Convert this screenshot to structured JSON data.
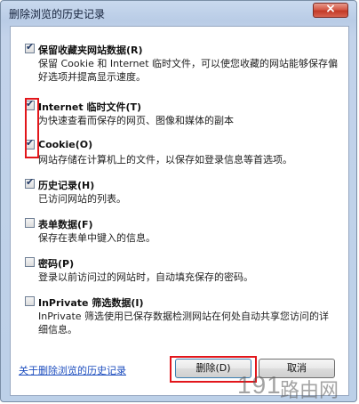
{
  "dialog": {
    "title": "删除浏览的历史记录",
    "close_symbol": "×"
  },
  "options": [
    {
      "key": "favorites",
      "checked": true,
      "title": "保留收藏夹网站数据(R)",
      "description": "保留 Cookie 和 Internet 临时文件，可以使您收藏的网站能够保存偏好选项并提高显示速度。"
    },
    {
      "key": "temp-files",
      "checked": true,
      "title": "Internet 临时文件(T)",
      "description": "为快速查看而保存的网页、图像和媒体的副本"
    },
    {
      "key": "cookies",
      "checked": true,
      "title": "Cookie(O)",
      "description": "网站存储在计算机上的文件，以保存如登录信息等首选项。"
    },
    {
      "key": "history",
      "checked": true,
      "title": "历史记录(H)",
      "description": "已访问网站的列表。"
    },
    {
      "key": "form-data",
      "checked": false,
      "title": "表单数据(F)",
      "description": "保存在表单中键入的信息。"
    },
    {
      "key": "passwords",
      "checked": false,
      "title": "密码(P)",
      "description": "登录以前访问过的网站时，自动填充保存的密码。"
    },
    {
      "key": "inprivate",
      "checked": false,
      "title": "InPrivate 筛选数据(I)",
      "description": "InPrivate 筛选使用已保存数据检测网站在何处自动共享您访问的详细信息。"
    }
  ],
  "footer": {
    "help_link": "关于删除浏览的历史记录",
    "delete_label": "删除(D)",
    "cancel_label": "取消"
  },
  "watermark": {
    "number": "191",
    "text": "路由网"
  },
  "colors": {
    "highlight": "#e2161b",
    "link": "#1f4fbf",
    "close_button": "#c23a27"
  }
}
